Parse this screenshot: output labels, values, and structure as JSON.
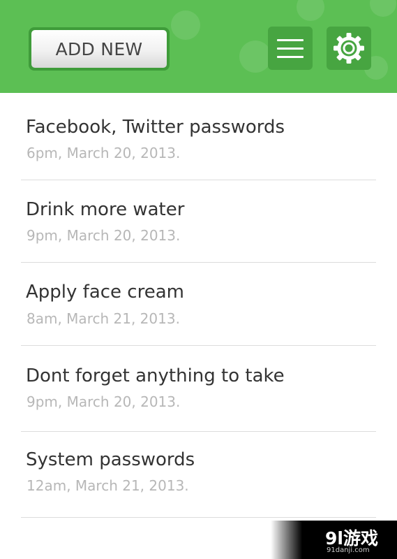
{
  "header": {
    "add_new_label": "ADD NEW",
    "menu_icon": "menu-icon",
    "settings_icon": "gear-icon",
    "accent_color": "#5cbf54"
  },
  "notes": [
    {
      "title": "Facebook, Twitter passwords",
      "date": "6pm, March 20, 2013."
    },
    {
      "title": "Drink more water",
      "date": "9pm, March 20, 2013."
    },
    {
      "title": "Apply face cream",
      "date": "8am, March 21, 2013."
    },
    {
      "title": "Dont forget anything to take",
      "date": "9pm, March 20, 2013."
    },
    {
      "title": "System passwords",
      "date": "12am, March 21, 2013."
    }
  ],
  "watermark": {
    "logo": "9l游戏",
    "url": "91danji.com"
  }
}
